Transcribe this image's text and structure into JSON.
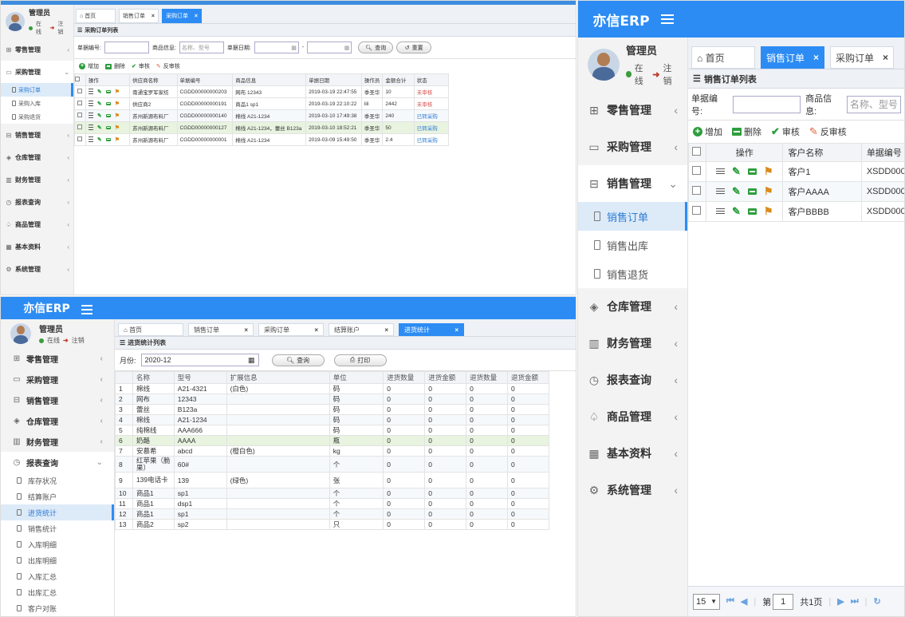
{
  "brand": "亦信ERP",
  "user": {
    "name": "管理员",
    "status": "在线",
    "logout": "注销"
  },
  "p1": {
    "nav": [
      {
        "label": "零售管理",
        "icon": "gift-icon",
        "open": false
      },
      {
        "label": "采购管理",
        "icon": "monitor-icon",
        "open": true
      },
      {
        "label": "销售管理",
        "icon": "briefcase-icon",
        "open": false
      },
      {
        "label": "仓库管理",
        "icon": "layers-icon",
        "open": false
      },
      {
        "label": "财务管理",
        "icon": "book-icon",
        "open": false
      },
      {
        "label": "报表查询",
        "icon": "clock-icon",
        "open": false
      },
      {
        "label": "商品管理",
        "icon": "tag-icon",
        "open": false
      },
      {
        "label": "基本资料",
        "icon": "grid-icon",
        "open": false
      },
      {
        "label": "系统管理",
        "icon": "gear-icon",
        "open": false
      }
    ],
    "subnav": [
      "采购订单",
      "采购入库",
      "采购退货"
    ],
    "tabs": [
      {
        "label": "首页",
        "home": true
      },
      {
        "label": "销售订单",
        "close": "×"
      },
      {
        "label": "采购订单",
        "close": "×",
        "active": true
      }
    ],
    "list_title": "采购订单列表",
    "search": {
      "no_label": "单据编号:",
      "goods_label": "商品信息:",
      "goods_placeholder": "名称、型号",
      "date_label": "单据日期:",
      "date_sep": "-",
      "query": "查询",
      "reset": "重置"
    },
    "toolbar": {
      "add": "增加",
      "delete": "删除",
      "audit": "审核",
      "unaudit": "反审核"
    },
    "columns": [
      "操作",
      "供应商名称",
      "单据编号",
      "商品信息",
      "单据日期",
      "操作员",
      "金额合计",
      "状态"
    ],
    "rows": [
      {
        "supplier": "南通宝罗军家纺",
        "no": "CGDD00000000203",
        "goods": "网布 12343",
        "date": "2019-03-19 22:47:55",
        "op": "季圣华",
        "amount": "10",
        "status": "未审核",
        "st": "red"
      },
      {
        "supplier": "供应商2",
        "no": "CGDD00000000191",
        "goods": "商品1 sp1",
        "date": "2019-03-19 22:10:22",
        "op": "lili",
        "amount": "2442",
        "status": "未审核",
        "st": "red"
      },
      {
        "supplier": "苏州新源布料厂",
        "no": "CGDD00000000140",
        "goods": "棉线 A21-1234",
        "date": "2019-03-10 17:49:38",
        "op": "季圣华",
        "amount": "240",
        "status": "已转采购",
        "st": "blue"
      },
      {
        "supplier": "苏州新源布料厂",
        "no": "CGDD00000000127",
        "goods": "棉线 A21-1234，蕾丝 B123a",
        "date": "2019-03-10 18:52:21",
        "op": "季圣华",
        "amount": "50",
        "status": "已转采购",
        "st": "blue"
      },
      {
        "supplier": "苏州新源布料厂",
        "no": "CGDD00000000001",
        "goods": "棉线 A21-1234",
        "date": "2019-03-09 15:49:50",
        "op": "季圣华",
        "amount": "2.4",
        "status": "已转采购",
        "st": "blue"
      }
    ]
  },
  "p2": {
    "nav": [
      {
        "label": "零售管理",
        "icon": "gift-icon",
        "open": false
      },
      {
        "label": "采购管理",
        "icon": "monitor-icon",
        "open": false
      },
      {
        "label": "销售管理",
        "icon": "briefcase-icon",
        "open": false
      },
      {
        "label": "仓库管理",
        "icon": "layers-icon",
        "open": false
      },
      {
        "label": "财务管理",
        "icon": "book-icon",
        "open": false
      },
      {
        "label": "报表查询",
        "icon": "clock-icon",
        "open": true
      }
    ],
    "subnav": [
      "库存状况",
      "结算账户",
      "进货统计",
      "销售统计",
      "入库明细",
      "出库明细",
      "入库汇总",
      "出库汇总",
      "客户对账"
    ],
    "active_sub": 2,
    "tabs": [
      {
        "label": "首页",
        "home": true
      },
      {
        "label": "销售订单",
        "close": "×"
      },
      {
        "label": "采购订单",
        "close": "×"
      },
      {
        "label": "结算账户",
        "close": "×"
      },
      {
        "label": "进货统计",
        "close": "×",
        "active": true
      }
    ],
    "list_title": "进货统计列表",
    "month_label": "月份:",
    "month_value": "2020-12",
    "query": "查询",
    "print": "打印",
    "columns": [
      "名称",
      "型号",
      "扩展信息",
      "单位",
      "进货数量",
      "进货金额",
      "退货数量",
      "退货金额"
    ],
    "rows": [
      [
        "1",
        "棉线",
        "A21-4321",
        "(白色)",
        "码",
        "0",
        "0",
        "0",
        "0"
      ],
      [
        "2",
        "网布",
        "12343",
        "",
        "码",
        "0",
        "0",
        "0",
        "0"
      ],
      [
        "3",
        "蕾丝",
        "B123a",
        "",
        "码",
        "0",
        "0",
        "0",
        "0"
      ],
      [
        "4",
        "棉线",
        "A21-1234",
        "",
        "码",
        "0",
        "0",
        "0",
        "0"
      ],
      [
        "5",
        "纯棉线",
        "AAA666",
        "",
        "码",
        "0",
        "0",
        "0",
        "0"
      ],
      [
        "6",
        "奶酪",
        "AAAA",
        "",
        "瓶",
        "0",
        "0",
        "0",
        "0"
      ],
      [
        "7",
        "安慕希",
        "abcd",
        "(橙白色)",
        "kg",
        "0",
        "0",
        "0",
        "0"
      ],
      [
        "8",
        "红苹果（脆果）",
        "60#",
        "",
        "个",
        "0",
        "0",
        "0",
        "0"
      ],
      [
        "9",
        "139电话卡",
        "139",
        "(绿色)",
        "张",
        "0",
        "0",
        "0",
        "0"
      ],
      [
        "10",
        "商品1",
        "sp1",
        "",
        "个",
        "0",
        "0",
        "0",
        "0"
      ],
      [
        "11",
        "商品1",
        "dsp1",
        "",
        "个",
        "0",
        "0",
        "0",
        "0"
      ],
      [
        "12",
        "商品1",
        "sp1",
        "",
        "个",
        "0",
        "0",
        "0",
        "0"
      ],
      [
        "13",
        "商品2",
        "sp2",
        "",
        "只",
        "0",
        "0",
        "0",
        "0"
      ]
    ]
  },
  "p3": {
    "nav": [
      {
        "label": "零售管理",
        "icon": "gift-icon",
        "open": false
      },
      {
        "label": "采购管理",
        "icon": "monitor-icon",
        "open": false
      },
      {
        "label": "销售管理",
        "icon": "briefcase-icon",
        "open": true
      }
    ],
    "subnav": [
      "销售订单",
      "销售出库",
      "销售退货"
    ],
    "nav_after": [
      {
        "label": "仓库管理",
        "icon": "layers-icon"
      },
      {
        "label": "财务管理",
        "icon": "book-icon"
      },
      {
        "label": "报表查询",
        "icon": "clock-icon"
      },
      {
        "label": "商品管理",
        "icon": "tag-icon"
      },
      {
        "label": "基本资料",
        "icon": "grid-icon"
      },
      {
        "label": "系统管理",
        "icon": "gear-icon"
      }
    ],
    "tabs": [
      {
        "label": "首页",
        "home": true
      },
      {
        "label": "销售订单",
        "close": "×",
        "active": true
      },
      {
        "label": "采购订单",
        "close": "×"
      }
    ],
    "list_title": "销售订单列表",
    "search": {
      "no_label": "单据编号:",
      "goods_label": "商品信息:",
      "goods_placeholder": "名称、型号"
    },
    "toolbar": {
      "add": "增加",
      "delete": "删除",
      "audit": "审核",
      "unaudit": "反审核"
    },
    "columns": [
      "操作",
      "客户名称",
      "单据编号"
    ],
    "rows": [
      {
        "customer": "客户1",
        "no": "XSDD000"
      },
      {
        "customer": "客户AAAA",
        "no": "XSDD000"
      },
      {
        "customer": "客户BBBB",
        "no": "XSDD000"
      }
    ],
    "pager": {
      "size": "15",
      "page_prefix": "第",
      "page": "1",
      "total": "共1页"
    }
  },
  "colors": {
    "accent": "#2c8cf4",
    "sidebar": "#f3f3f3",
    "success": "#2e9e3e",
    "danger": "#d9534f"
  }
}
